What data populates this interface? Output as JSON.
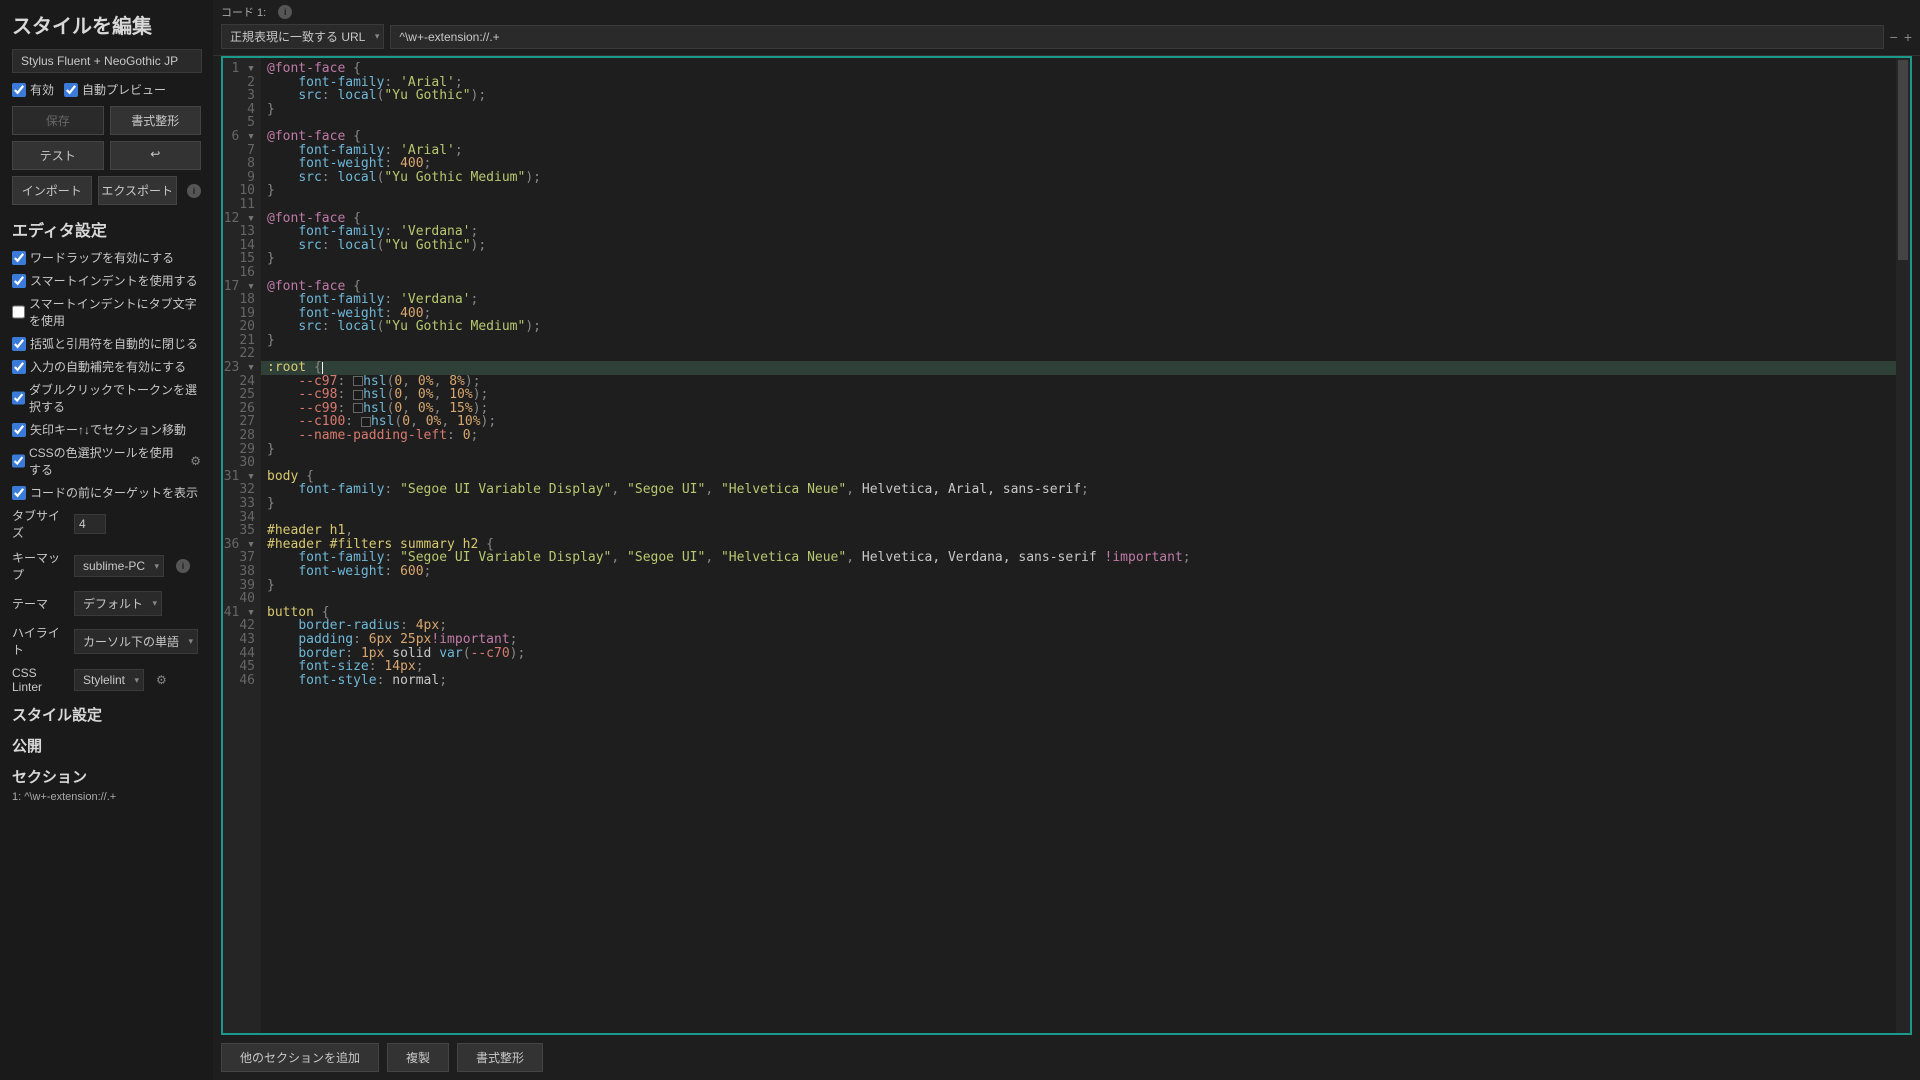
{
  "sidebar": {
    "title": "スタイルを編集",
    "style_name": "Stylus Fluent + NeoGothic JP",
    "enabled": {
      "label": "有効",
      "checked": true
    },
    "autopreview": {
      "label": "自動プレビュー",
      "checked": true
    },
    "buttons": {
      "save": "保存",
      "beautify": "書式整形",
      "test": "テスト",
      "back": "↩",
      "import": "インポート",
      "export": "エクスポート"
    },
    "editor_settings_title": "エディタ設定",
    "settings": [
      {
        "label": "ワードラップを有効にする",
        "checked": true
      },
      {
        "label": "スマートインデントを使用する",
        "checked": true
      },
      {
        "label": "スマートインデントにタブ文字を使用",
        "checked": false
      },
      {
        "label": "括弧と引用符を自動的に閉じる",
        "checked": true
      },
      {
        "label": "入力の自動補完を有効にする",
        "checked": true
      },
      {
        "label": "ダブルクリックでトークンを選択する",
        "checked": true
      },
      {
        "label": "矢印キー↑↓でセクション移動",
        "checked": true
      },
      {
        "label": "CSSの色選択ツールを使用する",
        "checked": true,
        "gear": true
      },
      {
        "label": "コードの前にターゲットを表示",
        "checked": true
      }
    ],
    "tab_size": {
      "label": "タブサイズ",
      "value": "4"
    },
    "keymap": {
      "label": "キーマップ",
      "value": "sublime-PC"
    },
    "theme": {
      "label": "テーマ",
      "value": "デフォルト"
    },
    "highlight": {
      "label": "ハイライト",
      "value": "カーソル下の単語"
    },
    "linter": {
      "label": "CSS Linter",
      "value": "Stylelint"
    },
    "sections": {
      "style_settings": "スタイル設定",
      "publish": "公開",
      "sections_title": "セクション",
      "toc_item": "1: ^\\w+-extension://.+"
    }
  },
  "main": {
    "code_label": "コード 1:",
    "applies_type": "正規表現に一致する URL",
    "applies_value": "^\\w+-extension://.+",
    "bottom": {
      "add_section": "他のセクションを追加",
      "clone": "複製",
      "beautify": "書式整形"
    }
  },
  "code_lines": [
    {
      "n": 1,
      "fold": true,
      "tokens": [
        [
          "kw",
          "@font-face"
        ],
        [
          "",
          ""
        ],
        [
          "punct",
          " {"
        ]
      ]
    },
    {
      "n": 2,
      "tokens": [
        [
          "",
          "    "
        ],
        [
          "prop",
          "font-family"
        ],
        [
          "punct",
          ": "
        ],
        [
          "str",
          "'Arial'"
        ],
        [
          "punct",
          ";"
        ]
      ]
    },
    {
      "n": 3,
      "tokens": [
        [
          "",
          "    "
        ],
        [
          "prop",
          "src"
        ],
        [
          "punct",
          ": "
        ],
        [
          "fn",
          "local"
        ],
        [
          "punct",
          "("
        ],
        [
          "str",
          "\"Yu Gothic\""
        ],
        [
          "punct",
          ");"
        ]
      ]
    },
    {
      "n": 4,
      "tokens": [
        [
          "punct",
          "}"
        ]
      ]
    },
    {
      "n": 5,
      "tokens": []
    },
    {
      "n": 6,
      "fold": true,
      "tokens": [
        [
          "kw",
          "@font-face"
        ],
        [
          "punct",
          " {"
        ]
      ]
    },
    {
      "n": 7,
      "tokens": [
        [
          "",
          "    "
        ],
        [
          "prop",
          "font-family"
        ],
        [
          "punct",
          ": "
        ],
        [
          "str",
          "'Arial'"
        ],
        [
          "punct",
          ";"
        ]
      ]
    },
    {
      "n": 8,
      "tokens": [
        [
          "",
          "    "
        ],
        [
          "prop",
          "font-weight"
        ],
        [
          "punct",
          ": "
        ],
        [
          "num",
          "400"
        ],
        [
          "punct",
          ";"
        ]
      ]
    },
    {
      "n": 9,
      "tokens": [
        [
          "",
          "    "
        ],
        [
          "prop",
          "src"
        ],
        [
          "punct",
          ": "
        ],
        [
          "fn",
          "local"
        ],
        [
          "punct",
          "("
        ],
        [
          "str",
          "\"Yu Gothic Medium\""
        ],
        [
          "punct",
          ");"
        ]
      ]
    },
    {
      "n": 10,
      "tokens": [
        [
          "punct",
          "}"
        ]
      ]
    },
    {
      "n": 11,
      "tokens": []
    },
    {
      "n": 12,
      "fold": true,
      "tokens": [
        [
          "kw",
          "@font-face"
        ],
        [
          "punct",
          " {"
        ]
      ]
    },
    {
      "n": 13,
      "tokens": [
        [
          "",
          "    "
        ],
        [
          "prop",
          "font-family"
        ],
        [
          "punct",
          ": "
        ],
        [
          "str",
          "'Verdana'"
        ],
        [
          "punct",
          ";"
        ]
      ]
    },
    {
      "n": 14,
      "tokens": [
        [
          "",
          "    "
        ],
        [
          "prop",
          "src"
        ],
        [
          "punct",
          ": "
        ],
        [
          "fn",
          "local"
        ],
        [
          "punct",
          "("
        ],
        [
          "str",
          "\"Yu Gothic\""
        ],
        [
          "punct",
          ");"
        ]
      ]
    },
    {
      "n": 15,
      "tokens": [
        [
          "punct",
          "}"
        ]
      ]
    },
    {
      "n": 16,
      "tokens": []
    },
    {
      "n": 17,
      "fold": true,
      "tokens": [
        [
          "kw",
          "@font-face"
        ],
        [
          "punct",
          " {"
        ]
      ]
    },
    {
      "n": 18,
      "tokens": [
        [
          "",
          "    "
        ],
        [
          "prop",
          "font-family"
        ],
        [
          "punct",
          ": "
        ],
        [
          "str",
          "'Verdana'"
        ],
        [
          "punct",
          ";"
        ]
      ]
    },
    {
      "n": 19,
      "tokens": [
        [
          "",
          "    "
        ],
        [
          "prop",
          "font-weight"
        ],
        [
          "punct",
          ": "
        ],
        [
          "num",
          "400"
        ],
        [
          "punct",
          ";"
        ]
      ]
    },
    {
      "n": 20,
      "tokens": [
        [
          "",
          "    "
        ],
        [
          "prop",
          "src"
        ],
        [
          "punct",
          ": "
        ],
        [
          "fn",
          "local"
        ],
        [
          "punct",
          "("
        ],
        [
          "str",
          "\"Yu Gothic Medium\""
        ],
        [
          "punct",
          ");"
        ]
      ]
    },
    {
      "n": 21,
      "tokens": [
        [
          "punct",
          "}"
        ]
      ]
    },
    {
      "n": 22,
      "tokens": []
    },
    {
      "n": 23,
      "fold": true,
      "active": true,
      "tokens": [
        [
          "sel",
          ":root"
        ],
        [
          "",
          " "
        ],
        [
          "punct",
          "{"
        ],
        [
          "cursor",
          ""
        ]
      ]
    },
    {
      "n": 24,
      "tokens": [
        [
          "",
          "    "
        ],
        [
          "var",
          "--c97"
        ],
        [
          "punct",
          ": "
        ],
        [
          "swatch",
          ""
        ],
        [
          "fn",
          "hsl"
        ],
        [
          "punct",
          "("
        ],
        [
          "num",
          "0"
        ],
        [
          "punct",
          ", "
        ],
        [
          "num",
          "0%"
        ],
        [
          "punct",
          ", "
        ],
        [
          "num",
          "8%"
        ],
        [
          "punct",
          ");"
        ]
      ]
    },
    {
      "n": 25,
      "tokens": [
        [
          "",
          "    "
        ],
        [
          "var",
          "--c98"
        ],
        [
          "punct",
          ": "
        ],
        [
          "swatch",
          ""
        ],
        [
          "fn",
          "hsl"
        ],
        [
          "punct",
          "("
        ],
        [
          "num",
          "0"
        ],
        [
          "punct",
          ", "
        ],
        [
          "num",
          "0%"
        ],
        [
          "punct",
          ", "
        ],
        [
          "num",
          "10%"
        ],
        [
          "punct",
          ");"
        ]
      ]
    },
    {
      "n": 26,
      "tokens": [
        [
          "",
          "    "
        ],
        [
          "var",
          "--c99"
        ],
        [
          "punct",
          ": "
        ],
        [
          "swatch",
          ""
        ],
        [
          "fn",
          "hsl"
        ],
        [
          "punct",
          "("
        ],
        [
          "num",
          "0"
        ],
        [
          "punct",
          ", "
        ],
        [
          "num",
          "0%"
        ],
        [
          "punct",
          ", "
        ],
        [
          "num",
          "15%"
        ],
        [
          "punct",
          ");"
        ]
      ]
    },
    {
      "n": 27,
      "tokens": [
        [
          "",
          "    "
        ],
        [
          "var",
          "--c100"
        ],
        [
          "punct",
          ": "
        ],
        [
          "swatch",
          ""
        ],
        [
          "fn",
          "hsl"
        ],
        [
          "punct",
          "("
        ],
        [
          "num",
          "0"
        ],
        [
          "punct",
          ", "
        ],
        [
          "num",
          "0%"
        ],
        [
          "punct",
          ", "
        ],
        [
          "num",
          "10%"
        ],
        [
          "punct",
          ");"
        ]
      ]
    },
    {
      "n": 28,
      "tokens": [
        [
          "",
          "    "
        ],
        [
          "var",
          "--name-padding-left"
        ],
        [
          "punct",
          ": "
        ],
        [
          "num",
          "0"
        ],
        [
          "punct",
          ";"
        ]
      ]
    },
    {
      "n": 29,
      "tokens": [
        [
          "punct",
          "}"
        ]
      ]
    },
    {
      "n": 30,
      "tokens": []
    },
    {
      "n": 31,
      "fold": true,
      "tokens": [
        [
          "sel",
          "body"
        ],
        [
          "punct",
          " {"
        ]
      ]
    },
    {
      "n": 32,
      "tokens": [
        [
          "",
          "    "
        ],
        [
          "prop",
          "font-family"
        ],
        [
          "punct",
          ": "
        ],
        [
          "str",
          "\"Segoe UI Variable Display\""
        ],
        [
          "punct",
          ", "
        ],
        [
          "str",
          "\"Segoe UI\""
        ],
        [
          "punct",
          ", "
        ],
        [
          "str",
          "\"Helvetica Neue\""
        ],
        [
          "punct",
          ", "
        ],
        [
          "",
          "Helvetica, Arial, sans-serif"
        ],
        [
          "punct",
          ";"
        ]
      ]
    },
    {
      "n": 33,
      "tokens": [
        [
          "punct",
          "}"
        ]
      ]
    },
    {
      "n": 34,
      "tokens": []
    },
    {
      "n": 35,
      "tokens": [
        [
          "sel",
          "#header h1"
        ],
        [
          "punct",
          ","
        ]
      ]
    },
    {
      "n": 36,
      "fold": true,
      "tokens": [
        [
          "sel",
          "#header #filters summary h2"
        ],
        [
          "punct",
          " {"
        ]
      ]
    },
    {
      "n": 37,
      "tokens": [
        [
          "",
          "    "
        ],
        [
          "prop",
          "font-family"
        ],
        [
          "punct",
          ": "
        ],
        [
          "str",
          "\"Segoe UI Variable Display\""
        ],
        [
          "punct",
          ", "
        ],
        [
          "str",
          "\"Segoe UI\""
        ],
        [
          "punct",
          ", "
        ],
        [
          "str",
          "\"Helvetica Neue\""
        ],
        [
          "punct",
          ", "
        ],
        [
          "",
          "Helvetica, Verdana, sans-serif "
        ],
        [
          "imp",
          "!important"
        ],
        [
          "punct",
          ";"
        ]
      ]
    },
    {
      "n": 38,
      "tokens": [
        [
          "",
          "    "
        ],
        [
          "prop",
          "font-weight"
        ],
        [
          "punct",
          ": "
        ],
        [
          "num",
          "600"
        ],
        [
          "punct",
          ";"
        ]
      ]
    },
    {
      "n": 39,
      "tokens": [
        [
          "punct",
          "}"
        ]
      ]
    },
    {
      "n": 40,
      "tokens": []
    },
    {
      "n": 41,
      "fold": true,
      "tokens": [
        [
          "sel",
          "button"
        ],
        [
          "punct",
          " {"
        ]
      ]
    },
    {
      "n": 42,
      "tokens": [
        [
          "",
          "    "
        ],
        [
          "prop",
          "border-radius"
        ],
        [
          "punct",
          ": "
        ],
        [
          "num",
          "4px"
        ],
        [
          "punct",
          ";"
        ]
      ]
    },
    {
      "n": 43,
      "tokens": [
        [
          "",
          "    "
        ],
        [
          "prop",
          "padding"
        ],
        [
          "punct",
          ": "
        ],
        [
          "num",
          "6px 25px"
        ],
        [
          "imp",
          "!important"
        ],
        [
          "punct",
          ";"
        ]
      ]
    },
    {
      "n": 44,
      "tokens": [
        [
          "",
          "    "
        ],
        [
          "prop",
          "border"
        ],
        [
          "punct",
          ": "
        ],
        [
          "num",
          "1px"
        ],
        [
          "",
          " solid "
        ],
        [
          "fn",
          "var"
        ],
        [
          "punct",
          "("
        ],
        [
          "var",
          "--c70"
        ],
        [
          "punct",
          ");"
        ]
      ]
    },
    {
      "n": 45,
      "tokens": [
        [
          "",
          "    "
        ],
        [
          "prop",
          "font-size"
        ],
        [
          "punct",
          ": "
        ],
        [
          "num",
          "14px"
        ],
        [
          "punct",
          ";"
        ]
      ]
    },
    {
      "n": 46,
      "tokens": [
        [
          "",
          "    "
        ],
        [
          "prop",
          "font-style"
        ],
        [
          "punct",
          ": "
        ],
        [
          "",
          "normal"
        ],
        [
          "punct",
          ";"
        ]
      ]
    }
  ]
}
